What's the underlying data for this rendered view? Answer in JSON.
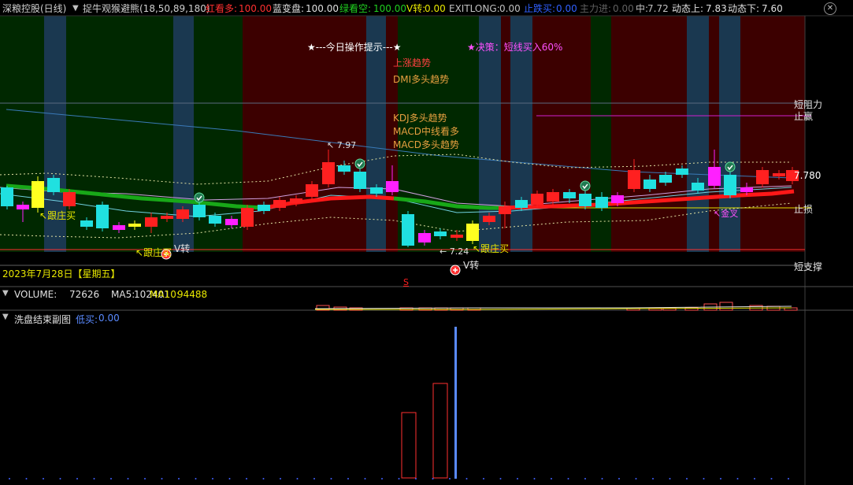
{
  "colors": {
    "bg": "#000000",
    "band_red": "#3c0000",
    "band_green": "#002800",
    "band_blue": "#1a3850",
    "candle_red": "#ff2020",
    "candle_cyan": "#20e0e0",
    "candle_magenta": "#ff20ff",
    "candle_yellow": "#ffff20",
    "ma_green": "#18a818",
    "ma_red": "#ff1818",
    "trend_blue": "#3a7ab8",
    "resist_magenta": "#d020d0",
    "stop_yellow": "#e0e000",
    "label_yellow": "#e8e800",
    "label_cyan": "#20e0e0",
    "label_magenta": "#ff50ff",
    "label_white": "#ffffff",
    "label_orange": "#e8a040",
    "bar_blue": "#5a8aff"
  },
  "header": {
    "title": "深粮控股(日线)",
    "indicator": "捉牛观猴避熊(18,50,89,180)",
    "red_bull_label": "红看多:",
    "red_bull_value": "100.00",
    "blue_change_label": "蓝变盘:",
    "blue_change_value": "100.00",
    "green_bear_label": "绿看空:",
    "green_bear_value": "100.00",
    "v_turn_label": "V转:",
    "v_turn_value": "0.00",
    "exitlong_label": "EXITLONG:",
    "exitlong_value": "0.00",
    "stop_fall_label": "止跌买:",
    "stop_fall_value": "0.00",
    "main_force_label": "主力进:",
    "main_force_value": "0.00",
    "mid_label": "中:",
    "mid_value": "7.72",
    "dyn_up_label": "动态上:",
    "dyn_up_value": "7.83",
    "dyn_down_label": "动态下:",
    "dyn_down_value": "7.60",
    "collapse_icon": "chevron-down-icon",
    "close_icon": "close-icon"
  },
  "chart_text": {
    "today_tip": "★---今日操作提示---★",
    "strategy": "★决策：短线买入60%",
    "trend_up": "上涨趋势",
    "dmi": "DMI多头趋势",
    "kdj": "KDJ多头趋势",
    "macd_mid": "MACD中线看多",
    "macd_bull": "MACD多头趋势",
    "high_mark": "7.97",
    "low_mark": "7.24",
    "last_price": "7.780",
    "short_resist": "短阻力",
    "take_profit": "止赢",
    "stop_loss": "止损",
    "short_support": "短支撑",
    "follow_buy_1": "跟庄买",
    "follow_buy_2": "跟庄买",
    "follow_buy_3": "跟庄买",
    "v_turn_1": "V转",
    "v_turn_2": "V转",
    "golden_cross": "金叉",
    "date": "2023年7月28日【星期五】",
    "s_mark": "S"
  },
  "volume": {
    "label": "VOLUME:",
    "value": "72626",
    "ma5_label": "MA5:",
    "ma5_value": "102401",
    "ma10_label": "MA10:",
    "ma10_value": "94488"
  },
  "sub_chart": {
    "title": "洗盘结束副图",
    "low_buy_label": "低买:",
    "low_buy_value": "0.00"
  }
}
